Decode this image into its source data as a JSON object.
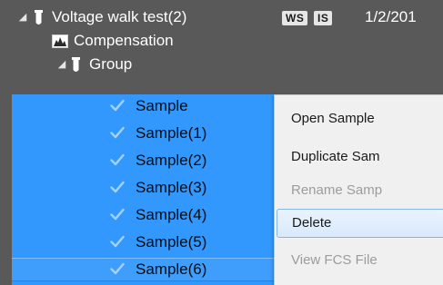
{
  "tree": {
    "experiment": {
      "label": "Voltage walk test(2)",
      "tags": [
        "WS",
        "IS"
      ],
      "date": "1/2/201"
    },
    "compensation": {
      "label": "Compensation"
    },
    "group": {
      "label": "Group"
    },
    "samples": [
      {
        "label": "Sample"
      },
      {
        "label": "Sample(1)"
      },
      {
        "label": "Sample(2)"
      },
      {
        "label": "Sample(3)"
      },
      {
        "label": "Sample(4)"
      },
      {
        "label": "Sample(5)"
      },
      {
        "label": "Sample(6)"
      }
    ]
  },
  "context_menu": {
    "items": [
      {
        "label": "Open Sample",
        "enabled": true
      },
      {
        "label": "Duplicate Sam",
        "enabled": true
      },
      {
        "label": "Rename Samp",
        "enabled": false
      },
      {
        "label": "Delete",
        "enabled": true,
        "highlighted": true
      },
      {
        "label": "View FCS File",
        "enabled": false
      }
    ]
  },
  "icons": {
    "expander": "triangle-down-icon",
    "tube": "test-tube-icon",
    "compensation": "chart-icon",
    "check": "checkmark-icon"
  },
  "colors": {
    "background": "#595959",
    "selection": "#3298fe",
    "menu_background": "#f0f0f0",
    "menu_hover_border": "#84b6ee",
    "disabled_text": "#9c9c9c"
  }
}
